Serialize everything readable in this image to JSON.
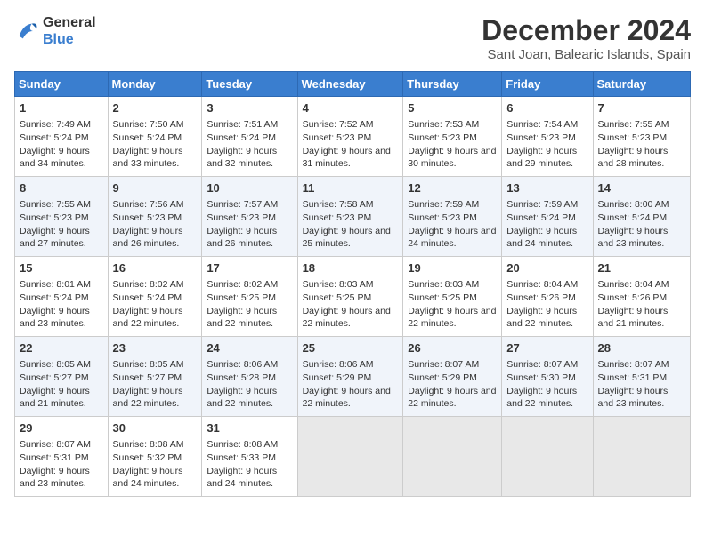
{
  "header": {
    "logo_line1": "General",
    "logo_line2": "Blue",
    "main_title": "December 2024",
    "subtitle": "Sant Joan, Balearic Islands, Spain"
  },
  "weekdays": [
    "Sunday",
    "Monday",
    "Tuesday",
    "Wednesday",
    "Thursday",
    "Friday",
    "Saturday"
  ],
  "weeks": [
    [
      {
        "day": "1",
        "sunrise": "7:49 AM",
        "sunset": "5:24 PM",
        "daylight": "9 hours and 34 minutes."
      },
      {
        "day": "2",
        "sunrise": "7:50 AM",
        "sunset": "5:24 PM",
        "daylight": "9 hours and 33 minutes."
      },
      {
        "day": "3",
        "sunrise": "7:51 AM",
        "sunset": "5:24 PM",
        "daylight": "9 hours and 32 minutes."
      },
      {
        "day": "4",
        "sunrise": "7:52 AM",
        "sunset": "5:23 PM",
        "daylight": "9 hours and 31 minutes."
      },
      {
        "day": "5",
        "sunrise": "7:53 AM",
        "sunset": "5:23 PM",
        "daylight": "9 hours and 30 minutes."
      },
      {
        "day": "6",
        "sunrise": "7:54 AM",
        "sunset": "5:23 PM",
        "daylight": "9 hours and 29 minutes."
      },
      {
        "day": "7",
        "sunrise": "7:55 AM",
        "sunset": "5:23 PM",
        "daylight": "9 hours and 28 minutes."
      }
    ],
    [
      {
        "day": "8",
        "sunrise": "7:55 AM",
        "sunset": "5:23 PM",
        "daylight": "9 hours and 27 minutes."
      },
      {
        "day": "9",
        "sunrise": "7:56 AM",
        "sunset": "5:23 PM",
        "daylight": "9 hours and 26 minutes."
      },
      {
        "day": "10",
        "sunrise": "7:57 AM",
        "sunset": "5:23 PM",
        "daylight": "9 hours and 26 minutes."
      },
      {
        "day": "11",
        "sunrise": "7:58 AM",
        "sunset": "5:23 PM",
        "daylight": "9 hours and 25 minutes."
      },
      {
        "day": "12",
        "sunrise": "7:59 AM",
        "sunset": "5:23 PM",
        "daylight": "9 hours and 24 minutes."
      },
      {
        "day": "13",
        "sunrise": "7:59 AM",
        "sunset": "5:24 PM",
        "daylight": "9 hours and 24 minutes."
      },
      {
        "day": "14",
        "sunrise": "8:00 AM",
        "sunset": "5:24 PM",
        "daylight": "9 hours and 23 minutes."
      }
    ],
    [
      {
        "day": "15",
        "sunrise": "8:01 AM",
        "sunset": "5:24 PM",
        "daylight": "9 hours and 23 minutes."
      },
      {
        "day": "16",
        "sunrise": "8:02 AM",
        "sunset": "5:24 PM",
        "daylight": "9 hours and 22 minutes."
      },
      {
        "day": "17",
        "sunrise": "8:02 AM",
        "sunset": "5:25 PM",
        "daylight": "9 hours and 22 minutes."
      },
      {
        "day": "18",
        "sunrise": "8:03 AM",
        "sunset": "5:25 PM",
        "daylight": "9 hours and 22 minutes."
      },
      {
        "day": "19",
        "sunrise": "8:03 AM",
        "sunset": "5:25 PM",
        "daylight": "9 hours and 22 minutes."
      },
      {
        "day": "20",
        "sunrise": "8:04 AM",
        "sunset": "5:26 PM",
        "daylight": "9 hours and 22 minutes."
      },
      {
        "day": "21",
        "sunrise": "8:04 AM",
        "sunset": "5:26 PM",
        "daylight": "9 hours and 21 minutes."
      }
    ],
    [
      {
        "day": "22",
        "sunrise": "8:05 AM",
        "sunset": "5:27 PM",
        "daylight": "9 hours and 21 minutes."
      },
      {
        "day": "23",
        "sunrise": "8:05 AM",
        "sunset": "5:27 PM",
        "daylight": "9 hours and 22 minutes."
      },
      {
        "day": "24",
        "sunrise": "8:06 AM",
        "sunset": "5:28 PM",
        "daylight": "9 hours and 22 minutes."
      },
      {
        "day": "25",
        "sunrise": "8:06 AM",
        "sunset": "5:29 PM",
        "daylight": "9 hours and 22 minutes."
      },
      {
        "day": "26",
        "sunrise": "8:07 AM",
        "sunset": "5:29 PM",
        "daylight": "9 hours and 22 minutes."
      },
      {
        "day": "27",
        "sunrise": "8:07 AM",
        "sunset": "5:30 PM",
        "daylight": "9 hours and 22 minutes."
      },
      {
        "day": "28",
        "sunrise": "8:07 AM",
        "sunset": "5:31 PM",
        "daylight": "9 hours and 23 minutes."
      }
    ],
    [
      {
        "day": "29",
        "sunrise": "8:07 AM",
        "sunset": "5:31 PM",
        "daylight": "9 hours and 23 minutes."
      },
      {
        "day": "30",
        "sunrise": "8:08 AM",
        "sunset": "5:32 PM",
        "daylight": "9 hours and 24 minutes."
      },
      {
        "day": "31",
        "sunrise": "8:08 AM",
        "sunset": "5:33 PM",
        "daylight": "9 hours and 24 minutes."
      },
      null,
      null,
      null,
      null
    ]
  ],
  "labels": {
    "sunrise": "Sunrise:",
    "sunset": "Sunset:",
    "daylight": "Daylight:"
  }
}
